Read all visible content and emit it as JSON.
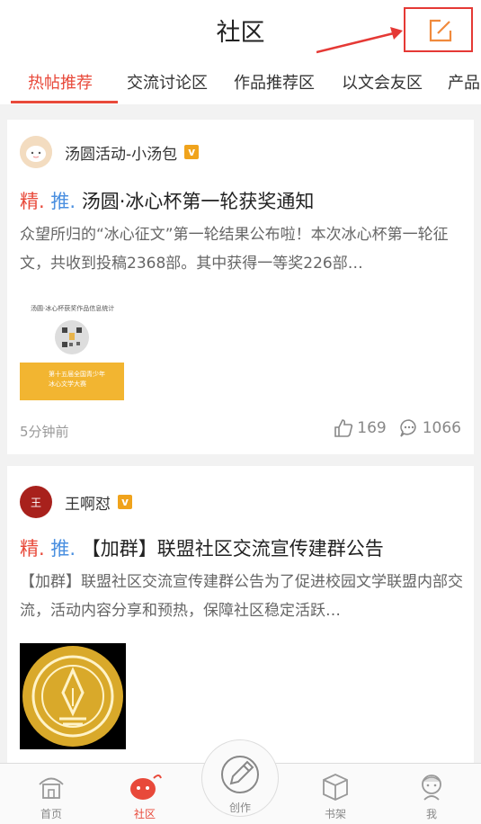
{
  "header": {
    "title": "社区"
  },
  "tabs": [
    {
      "label": "热帖推荐",
      "active": true
    },
    {
      "label": "交流讨论区"
    },
    {
      "label": "作品推荐区"
    },
    {
      "label": "以文会友区"
    },
    {
      "label": "产品"
    }
  ],
  "posts": [
    {
      "author": "汤圆活动-小汤包",
      "badge": "v",
      "tag_jing": "精.",
      "tag_tui": "推.",
      "title": "汤圆·冰心杯第一轮获奖通知",
      "body": "众望所归的“冰心征文”第一轮结果公布啦！本次冰心杯第一轮征文，共收到投稿2368部。其中获得一等奖226部…",
      "thumb_caption": "汤圆·冰心杯获奖作品信息统计",
      "thumb_banner_line1": "第十五届全国青少年",
      "thumb_banner_line2": "冰心文学大赛",
      "time": "5分钟前",
      "likes": "169",
      "comments": "1066"
    },
    {
      "author": "王啊怼",
      "avatar_text": "王",
      "badge": "v",
      "tag_jing": "精.",
      "tag_tui": "推.",
      "title": "【加群】联盟社区交流宣传建群公告",
      "body": "【加群】联盟社区交流宣传建群公告为了促进校园文学联盟内部交流，活动内容分享和预热，保障社区稳定活跃…"
    }
  ],
  "bottom_nav": [
    {
      "label": "首页",
      "icon": "home-icon"
    },
    {
      "label": "社区",
      "icon": "community-icon",
      "active": true
    },
    {
      "label": "创作",
      "icon": "pen-icon"
    },
    {
      "label": "书架",
      "icon": "bookshelf-icon"
    },
    {
      "label": "我",
      "icon": "profile-icon"
    }
  ],
  "colors": {
    "accent": "#e8493a",
    "tag_blue": "#4a8fe0",
    "badge": "#f0a31c",
    "annotation": "#e53935"
  }
}
